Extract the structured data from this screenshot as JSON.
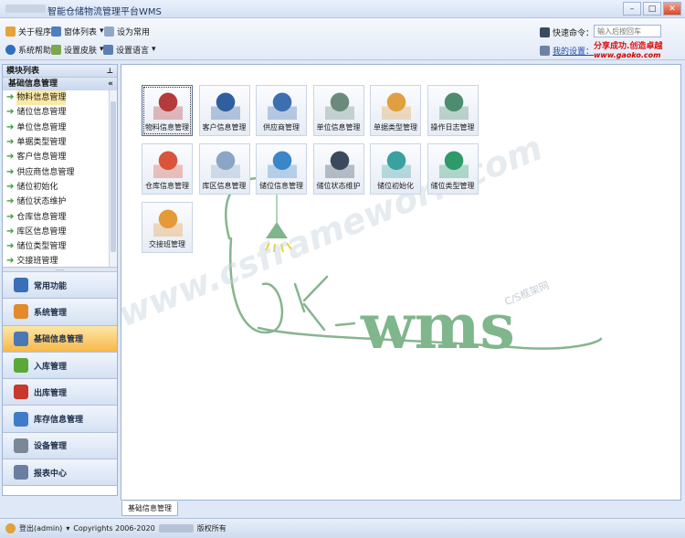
{
  "window": {
    "title": "智能仓储物流管理平台WMS"
  },
  "toolbar": {
    "about": "关于程序",
    "window_list": "窗体列表",
    "set_common": "设为常用",
    "help": "系统帮助",
    "skin": "设置皮肤",
    "language": "设置语言",
    "quick_command_label": "快速命令：",
    "quick_command_placeholder": "输入后按回车",
    "my_settings": "我的设置：",
    "promo_text": "分享成功.创造卓越",
    "promo_url": "www.gaoko.com"
  },
  "left_panel": {
    "title": "模块列表",
    "group_title": "基础信息管理",
    "tree_items": [
      {
        "label": "物料信息管理",
        "selected": true
      },
      {
        "label": "储位信息管理"
      },
      {
        "label": "单位信息管理"
      },
      {
        "label": "单据类型管理"
      },
      {
        "label": "客户信息管理"
      },
      {
        "label": "供应商信息管理"
      },
      {
        "label": "储位初始化"
      },
      {
        "label": "储位状态维护"
      },
      {
        "label": "仓库信息管理"
      },
      {
        "label": "库区信息管理"
      },
      {
        "label": "储位类型管理"
      },
      {
        "label": "交接班管理"
      }
    ],
    "nav_buttons": [
      {
        "label": "常用功能",
        "icon": "magnifier-icon"
      },
      {
        "label": "系统管理",
        "icon": "gear-flower-icon"
      },
      {
        "label": "基础信息管理",
        "icon": "magnifier-doc-icon",
        "active": true
      },
      {
        "label": "入库管理",
        "icon": "inbound-icon"
      },
      {
        "label": "出库管理",
        "icon": "outbound-icon"
      },
      {
        "label": "库存信息管理",
        "icon": "bar-chart-icon"
      },
      {
        "label": "设备管理",
        "icon": "gear-icon"
      },
      {
        "label": "报表中心",
        "icon": "report-icon"
      }
    ]
  },
  "tiles": [
    {
      "label": "物料信息管理",
      "icon": "cart-icon",
      "selected": true
    },
    {
      "label": "客户信息管理",
      "icon": "customer-icon"
    },
    {
      "label": "供应商管理",
      "icon": "supplier-icon"
    },
    {
      "label": "单位信息管理",
      "icon": "unit-icon"
    },
    {
      "label": "单据类型管理",
      "icon": "clipboard-icon"
    },
    {
      "label": "操作日志管理",
      "icon": "log-book-icon"
    },
    {
      "label": "仓库信息管理",
      "icon": "warehouse-icon"
    },
    {
      "label": "库区信息管理",
      "icon": "zone-icon"
    },
    {
      "label": "储位信息管理",
      "icon": "storage-search-icon"
    },
    {
      "label": "储位状态维护",
      "icon": "maintenance-icon"
    },
    {
      "label": "储位初始化",
      "icon": "init-gear-icon"
    },
    {
      "label": "储位类型管理",
      "icon": "chart-board-icon"
    },
    {
      "label": "交接班管理",
      "icon": "shift-icon"
    }
  ],
  "watermark": {
    "logo_text": "k-wms",
    "url": "www.csframework.com",
    "cs_text": "C/S框架网"
  },
  "tabs": [
    {
      "label": "基础信息管理"
    }
  ],
  "status": {
    "user": "登出(admin)",
    "copyright": "Copyrights 2006-2020",
    "rights": "版权所有"
  },
  "colors": {
    "accent": "#f6b94a",
    "panel_border": "#9fb3d4",
    "logo_green": "#7fb68b"
  }
}
